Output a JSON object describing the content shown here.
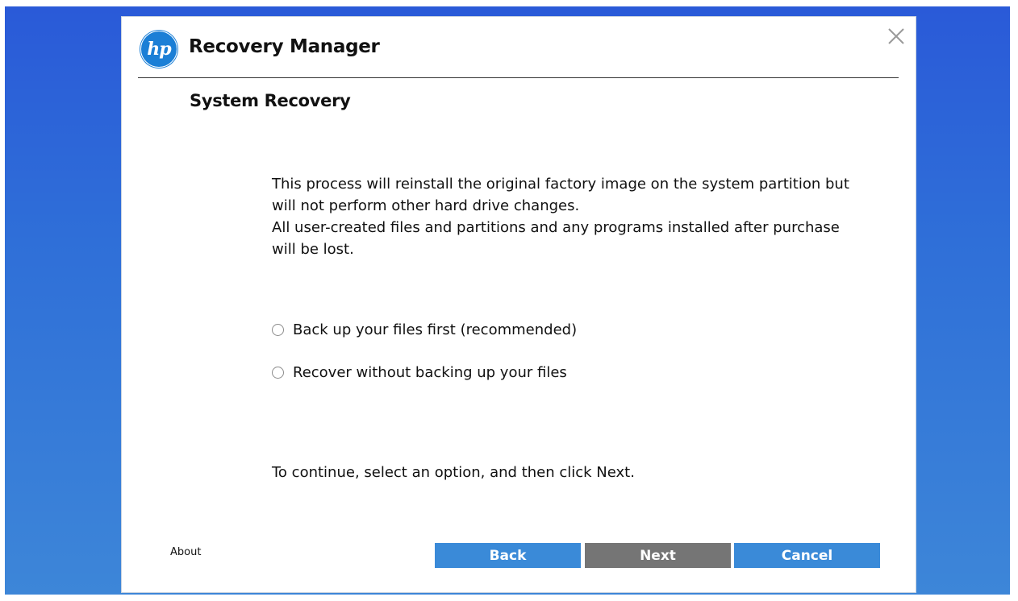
{
  "app": {
    "logo_text": "hp",
    "title": "Recovery Manager",
    "close_icon": "close-icon"
  },
  "page": {
    "section_title": "System Recovery",
    "description_lines": [
      "This process will reinstall the original factory image on the system partition but",
      "will not perform other hard drive changes.",
      "All user-created files and partitions and any programs installed after purchase",
      "will be lost."
    ],
    "options": [
      {
        "label": "Back up your files first (recommended)",
        "selected": false
      },
      {
        "label": "Recover without backing up your files",
        "selected": false
      }
    ],
    "instruction": "To continue, select an option, and then click Next."
  },
  "footer": {
    "about_label": "About",
    "back_label": "Back",
    "next_label": "Next",
    "cancel_label": "Cancel"
  },
  "colors": {
    "accent_blue": "#3a8ad8",
    "disabled_gray": "#757575",
    "logo_blue": "#1b7fd6"
  }
}
